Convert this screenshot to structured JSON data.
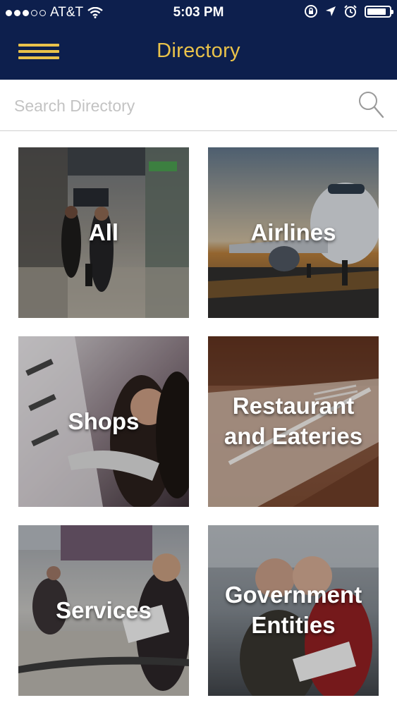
{
  "status_bar": {
    "carrier": "AT&T",
    "time": "5:03 PM",
    "signal_bars_filled": 3,
    "signal_bars_total": 5,
    "battery_level": 0.85
  },
  "header": {
    "title": "Directory",
    "menu_icon": "hamburger-menu-icon",
    "accent_color": "#e9c24a",
    "background_color": "#0d1f4d"
  },
  "search": {
    "placeholder": "Search Directory",
    "value": "",
    "icon": "search-icon"
  },
  "categories": [
    {
      "label": "All",
      "image": "airport-travelers-photo"
    },
    {
      "label": "Airlines",
      "image": "airplane-on-tarmac-photo"
    },
    {
      "label": "Shops",
      "image": "shopping-women-photo"
    },
    {
      "label": "Restaurant and Eateries",
      "label_display": "Restaurant\nand Eateries",
      "image": "fork-on-table-photo"
    },
    {
      "label": "Services",
      "image": "lounge-seating-photo"
    },
    {
      "label": "Government Entities",
      "label_display": "Government\nEntities",
      "image": "elderly-couple-photo"
    }
  ]
}
